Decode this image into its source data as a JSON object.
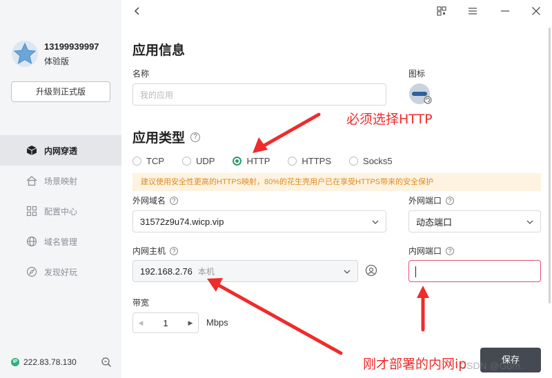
{
  "sidebar": {
    "user_name": "13199939997",
    "plan": "体验版",
    "upgrade_label": "升级到正式版",
    "items": [
      {
        "label": "内网穿透",
        "icon": "cube-icon",
        "active": true
      },
      {
        "label": "场景映射",
        "icon": "house-icon",
        "active": false
      },
      {
        "label": "配置中心",
        "icon": "grid-icon",
        "active": false
      },
      {
        "label": "域名管理",
        "icon": "globe-icon",
        "active": false
      },
      {
        "label": "发现好玩",
        "icon": "compass-icon",
        "active": false
      }
    ],
    "ip_badge": "IP",
    "ip": "222.83.78.130"
  },
  "app_info": {
    "title": "应用信息",
    "name_label": "名称",
    "name_placeholder": "我的应用",
    "icon_label": "图标"
  },
  "app_type": {
    "title": "应用类型",
    "help": "?",
    "options": [
      "TCP",
      "UDP",
      "HTTP",
      "HTTPS",
      "Socks5"
    ],
    "selected": "HTTP",
    "warning": "建议使用安全性更高的HTTPS映射，80%的花生壳用户已在享受HTTPS带来的安全保护"
  },
  "external": {
    "domain_label": "外网域名",
    "domain_value": "31572z9u74.wicp.vip",
    "port_label": "外网端口",
    "port_value": "动态端口"
  },
  "internal": {
    "host_label": "内网主机",
    "host_value": "192.168.2.76",
    "host_tag": "本机",
    "port_label": "内网端口",
    "port_value": ""
  },
  "bandwidth": {
    "label": "带宽",
    "value": "1",
    "unit": "Mbps"
  },
  "save_label": "保存",
  "annotations": {
    "http_note": "必须选择HTTP",
    "ip_note": "刚才部署的内网ip",
    "color": "#f02b2b"
  },
  "watermark": "CSDN @Gum."
}
